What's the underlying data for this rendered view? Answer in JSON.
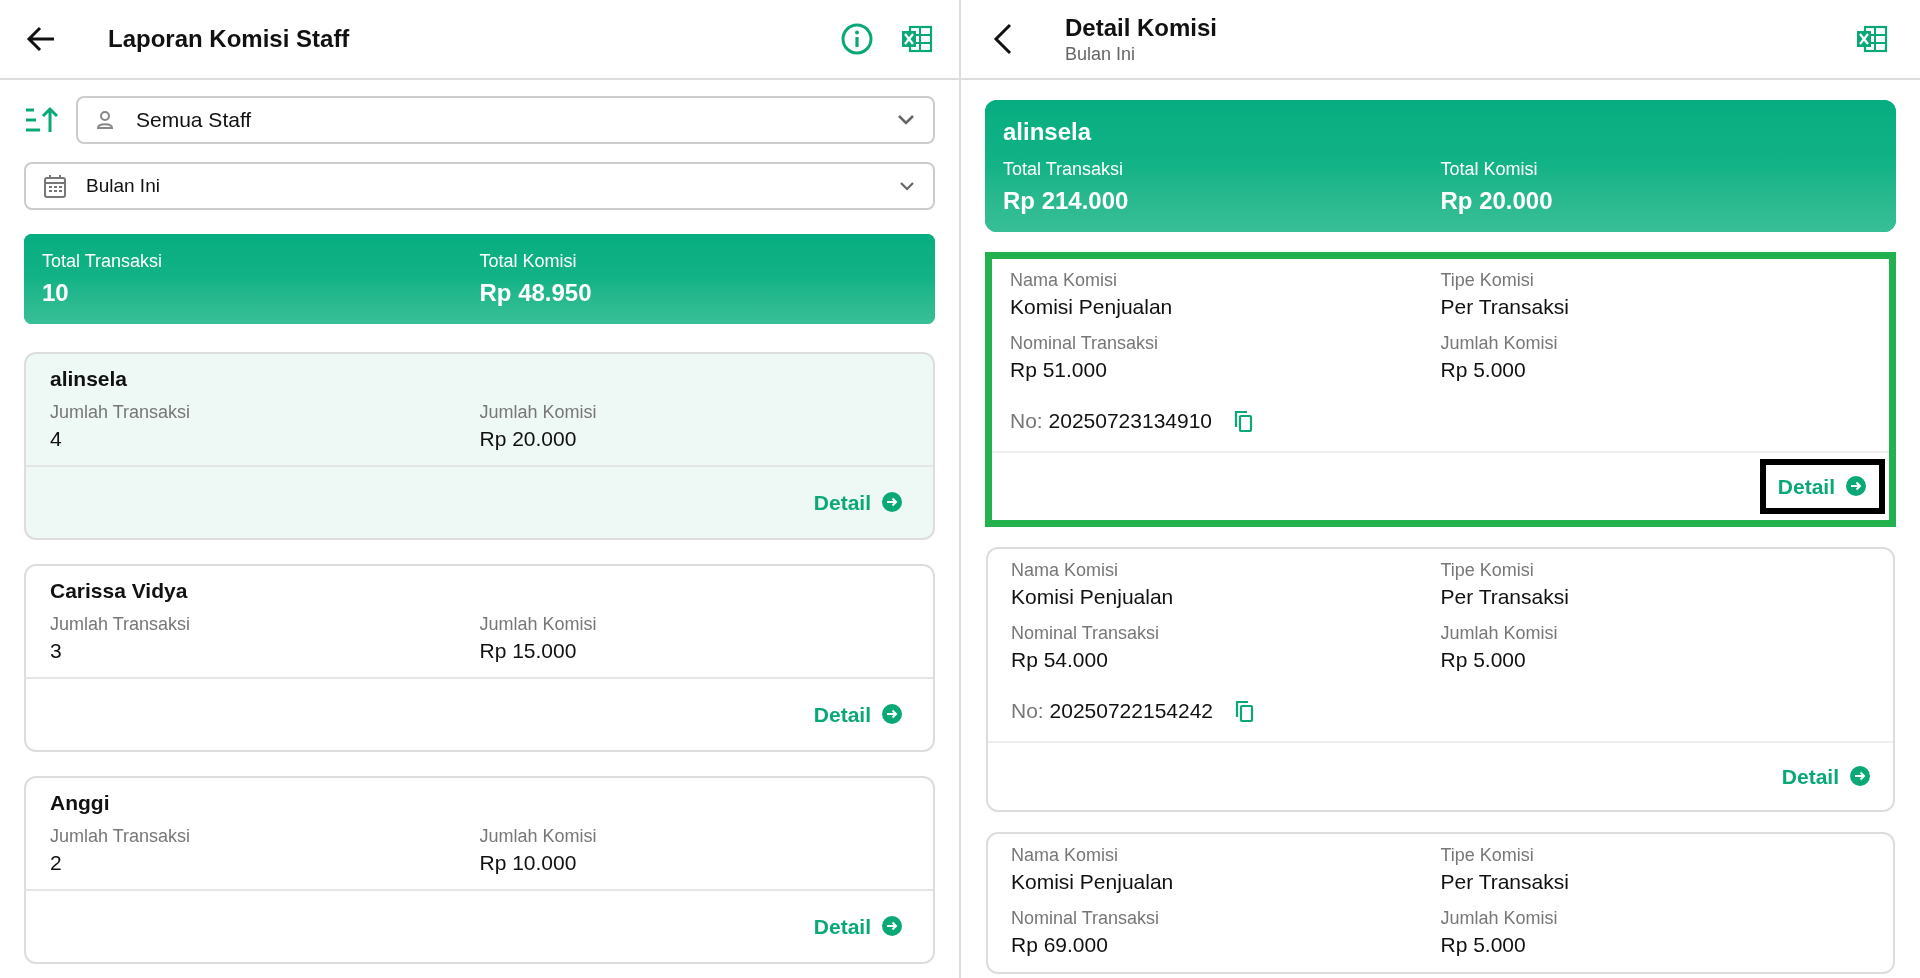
{
  "left": {
    "header": {
      "title": "Laporan Komisi Staff"
    },
    "staff_filter": {
      "value": "Semua Staff"
    },
    "period_filter": {
      "value": "Bulan Ini"
    },
    "summary": [
      {
        "label": "Total Transaksi",
        "value": "10"
      },
      {
        "label": "Total Komisi",
        "value": "Rp 48.950"
      }
    ],
    "staff": [
      {
        "name": "alinsela",
        "selected": true,
        "fields": [
          {
            "label": "Jumlah Transaksi",
            "value": "4"
          },
          {
            "label": "Jumlah Komisi",
            "value": "Rp 20.000"
          }
        ],
        "action": "Detail"
      },
      {
        "name": "Carissa Vidya",
        "selected": false,
        "fields": [
          {
            "label": "Jumlah Transaksi",
            "value": "3"
          },
          {
            "label": "Jumlah Komisi",
            "value": "Rp 15.000"
          }
        ],
        "action": "Detail"
      },
      {
        "name": "Anggi",
        "selected": false,
        "fields": [
          {
            "label": "Jumlah Transaksi",
            "value": "2"
          },
          {
            "label": "Jumlah Komisi",
            "value": "Rp 10.000"
          }
        ],
        "action": "Detail"
      }
    ]
  },
  "right": {
    "header": {
      "title": "Detail Komisi",
      "subtitle": "Bulan Ini"
    },
    "summary": {
      "name": "alinsela",
      "items": [
        {
          "label": "Total Transaksi",
          "value": "Rp 214.000"
        },
        {
          "label": "Total Komisi",
          "value": "Rp 20.000"
        }
      ]
    },
    "commissions": [
      {
        "highlighted": true,
        "fields": [
          {
            "label": "Nama Komisi",
            "value": "Komisi Penjualan"
          },
          {
            "label": "Tipe Komisi",
            "value": "Per Transaksi"
          },
          {
            "label": "Nominal Transaksi",
            "value": "Rp 51.000"
          },
          {
            "label": "Jumlah Komisi",
            "value": "Rp 5.000"
          }
        ],
        "number_label": "No:",
        "number": "20250723134910",
        "action": "Detail"
      },
      {
        "highlighted": false,
        "fields": [
          {
            "label": "Nama Komisi",
            "value": "Komisi Penjualan"
          },
          {
            "label": "Tipe Komisi",
            "value": "Per Transaksi"
          },
          {
            "label": "Nominal Transaksi",
            "value": "Rp 54.000"
          },
          {
            "label": "Jumlah Komisi",
            "value": "Rp 5.000"
          }
        ],
        "number_label": "No:",
        "number": "20250722154242",
        "action": "Detail"
      },
      {
        "highlighted": false,
        "fields": [
          {
            "label": "Nama Komisi",
            "value": "Komisi Penjualan"
          },
          {
            "label": "Tipe Komisi",
            "value": "Per Transaksi"
          },
          {
            "label": "Nominal Transaksi",
            "value": "Rp 69.000"
          },
          {
            "label": "Jumlah Komisi",
            "value": "Rp 5.000"
          }
        ]
      }
    ]
  }
}
